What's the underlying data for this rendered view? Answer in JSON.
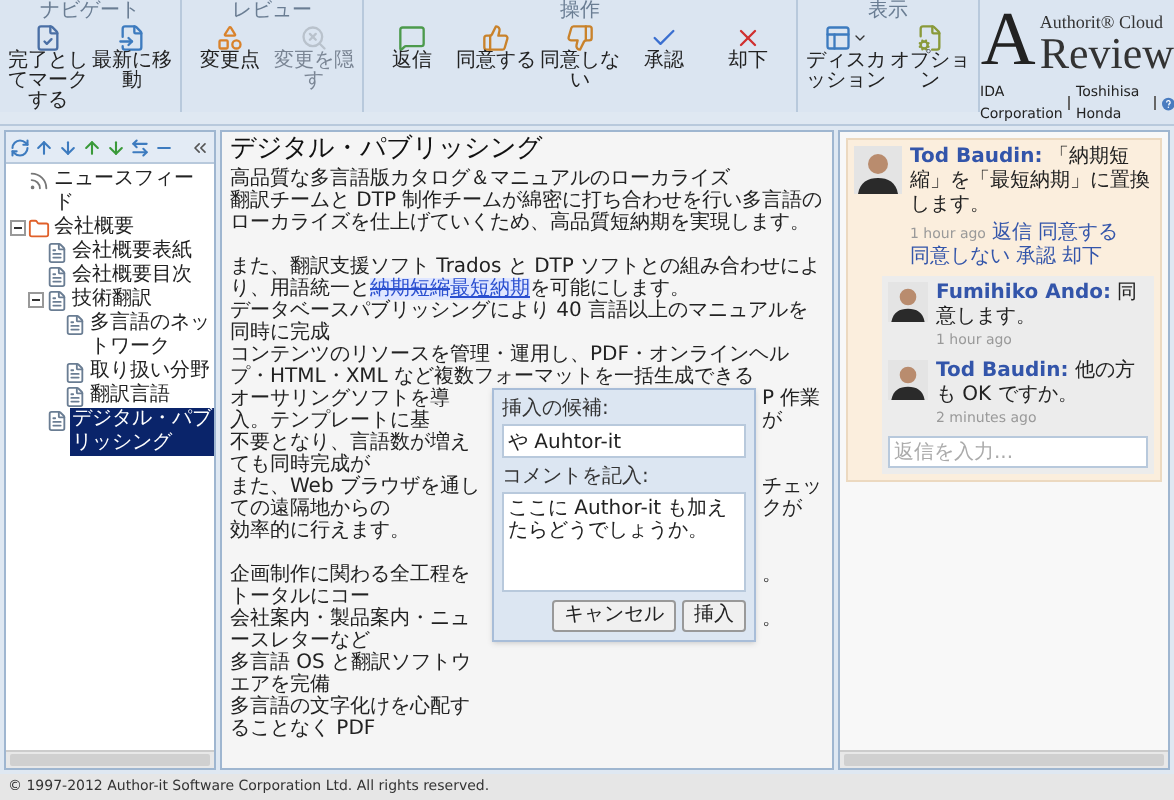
{
  "toolbar": {
    "groups": [
      {
        "label": "ナビゲート",
        "buttons": [
          {
            "label": "完了としてマークする",
            "disabled": false,
            "dropdown": false
          },
          {
            "label": "最新に移動",
            "disabled": false,
            "dropdown": false
          }
        ]
      },
      {
        "label": "レビュー",
        "buttons": [
          {
            "label": "変更点",
            "disabled": false,
            "dropdown": false
          },
          {
            "label": "変更を隠す",
            "disabled": true,
            "dropdown": false
          }
        ]
      },
      {
        "label": "操作",
        "buttons": [
          {
            "label": "返信",
            "disabled": false,
            "dropdown": false
          },
          {
            "label": "同意する",
            "disabled": false,
            "dropdown": false
          },
          {
            "label": "同意しない",
            "disabled": false,
            "dropdown": false
          },
          {
            "label": "承認",
            "disabled": false,
            "dropdown": false
          },
          {
            "label": "却下",
            "disabled": false,
            "dropdown": false
          }
        ]
      },
      {
        "label": "表示",
        "buttons": [
          {
            "label": "ディスカッション",
            "disabled": false,
            "dropdown": true
          },
          {
            "label": "オプション",
            "disabled": false,
            "dropdown": false
          }
        ]
      }
    ]
  },
  "brand": {
    "logo_letter": "A",
    "product_top": "Authorit® Cloud",
    "product_name": "Review",
    "organization": "IDA Corporation",
    "user": "Toshihisa Honda"
  },
  "sidebar": {
    "tree": [
      {
        "label": "ニュースフィード",
        "kind": "feed",
        "selected": false
      },
      {
        "label": "会社概要",
        "kind": "folder",
        "selected": false,
        "expanded": true,
        "children": [
          {
            "label": "会社概要表紙",
            "kind": "page",
            "selected": false
          },
          {
            "label": "会社概要目次",
            "kind": "page",
            "selected": false
          },
          {
            "label": "技術翻訳",
            "kind": "page",
            "selected": false,
            "expanded": true,
            "children": [
              {
                "label": "多言語のネットワーク",
                "kind": "page",
                "selected": false
              },
              {
                "label": "取り扱い分野",
                "kind": "page",
                "selected": false
              },
              {
                "label": "翻訳言語",
                "kind": "page",
                "selected": false
              }
            ]
          },
          {
            "label": "デジタル・パブリッシング",
            "kind": "page",
            "selected": true
          }
        ]
      }
    ]
  },
  "document": {
    "title": "デジタル・パブリッシング",
    "lines": [
      {
        "kind": "text",
        "text": "高品質な多言語版カタログ＆マニュアルのローカライズ"
      },
      {
        "kind": "text",
        "text": "翻訳チームと DTP 制作チームが綿密に打ち合わせを行い多言語のローカライズを仕上げていくため、高品質短納期を実現します。"
      },
      {
        "kind": "blank"
      },
      {
        "kind": "tracked",
        "segments": [
          {
            "kind": "plain",
            "text": "また、翻訳支援ソフト Trados と DTP ソフトとの組み合わせにより、用語統一と"
          },
          {
            "kind": "deleted",
            "text": "納期短縮"
          },
          {
            "kind": "inserted",
            "text": "最短納期"
          },
          {
            "kind": "plain",
            "text": "を可能にします。"
          }
        ]
      },
      {
        "kind": "text",
        "text": "データベースパブリッシングにより 40 言語以上のマニュアルを同時に完成"
      },
      {
        "kind": "text",
        "text": "コンテンツのリソースを管理・運用し、PDF・オンラインヘルプ・HTML・XML など複数フォーマットを一括生成できる"
      }
    ],
    "covered_lines": [
      {
        "kind": "text",
        "left": "オーサリングソフトを導入。テンプレートに基",
        "right": "P 作業が"
      },
      {
        "kind": "text",
        "left": "不要となり、言語数が増えても同時完成が"
      },
      {
        "kind": "text",
        "left": "また、Web ブラウザを通しての遠隔地からの",
        "right": "チェックが"
      },
      {
        "kind": "text",
        "left": "効率的に行えます。"
      },
      {
        "kind": "blank"
      },
      {
        "kind": "text",
        "left": "企画制作に関わる全工程をトータルにコー",
        "right": "。"
      },
      {
        "kind": "text",
        "left": "会社案内・製品案内・ニュースレターなど",
        "right": "。"
      },
      {
        "kind": "text",
        "left": "多言語 OS と翻訳ソフトウエアを完備"
      },
      {
        "kind": "text",
        "left": "多言語の文字化けを心配することなく PDF"
      }
    ],
    "insert_dialog": {
      "candidate_label": "挿入の候補:",
      "candidate_value": "や Auhtor-it",
      "comment_label": "コメントを記入:",
      "comment_value": "ここに Author-it も加えたらどうでしょうか。",
      "buttons": [
        "キャンセル",
        "挿入"
      ]
    }
  },
  "discussion": {
    "comment": {
      "author": "Tod Baudin:",
      "text": "「納期短縮」を「最短納期」に置換します。",
      "time": "1 hour ago",
      "actions": [
        "返信",
        "同意する",
        "同意しない",
        "承認",
        "却下"
      ]
    },
    "replies": [
      {
        "author": "Fumihiko Ando:",
        "text": "同意します。",
        "time": "1 hour ago"
      },
      {
        "author": "Tod Baudin:",
        "text": "他の方も OK ですか。",
        "time": "2 minutes ago"
      }
    ],
    "reply_field": {
      "placeholder": "返信を入力..."
    }
  },
  "status_bar": {
    "copyright": "© 1997-2012 Author-it Software Corporation Ltd. All rights reserved."
  }
}
